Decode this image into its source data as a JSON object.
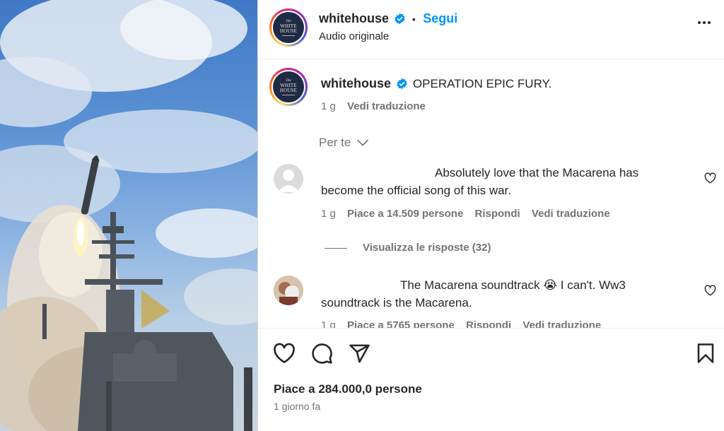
{
  "post": {
    "username": "whitehouse",
    "follow_label": "Segui",
    "dot": "•",
    "audio": "Audio originale",
    "avatar_line1": "The",
    "avatar_line2": "WHITE",
    "avatar_line3": "HOUSE"
  },
  "caption": {
    "username": "whitehouse",
    "text": "OPERATION EPIC FURY.",
    "age": "1 g",
    "translate": "Vedi traduzione"
  },
  "filter": {
    "label": "Per te"
  },
  "comments": [
    {
      "line1": "Absolutely love that the Macarena has",
      "line2": "become the official song of this war.",
      "age": "1 g",
      "likes": "Piace a 14.509 persone",
      "reply": "Rispondi",
      "translate": "Vedi traduzione",
      "view_replies": "Visualizza le risposte (32)"
    },
    {
      "line1": "The Macarena soundtrack 😭 I can't. Ww3",
      "line2": "soundtrack is the Macarena.",
      "age": "1 g",
      "likes": "Piace a 5765 persone",
      "reply": "Rispondi",
      "translate": "Vedi traduzione"
    }
  ],
  "footer": {
    "likes": "Piace a 284.000,0 persone",
    "time": "1 giorno fa"
  },
  "colors": {
    "accent": "#0095f6",
    "verified": "#0095f6",
    "text": "#262626",
    "muted": "#737373"
  },
  "icons": [
    "verified-badge-icon",
    "more-options-icon",
    "chevron-down-icon",
    "heart-icon",
    "comment-icon",
    "share-icon",
    "bookmark-icon"
  ]
}
